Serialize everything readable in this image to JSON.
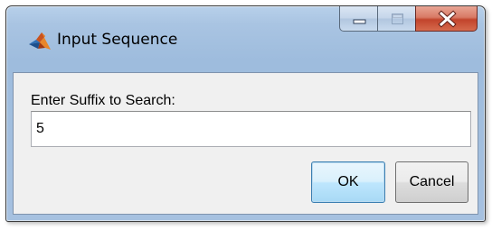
{
  "window": {
    "title": "Input Sequence",
    "app_icon": "matlab-membrane-icon",
    "caption_buttons": {
      "minimize_icon": "minimize-icon",
      "maximize_icon": "maximize-icon",
      "close_icon": "close-icon"
    }
  },
  "dialog": {
    "prompt": "Enter Suffix to Search:",
    "input_value": "5",
    "ok_label": "OK",
    "cancel_label": "Cancel"
  },
  "colors": {
    "frame": "#a9c4e2",
    "close_button": "#c2442c",
    "client_background": "#f0f0f0",
    "default_button_border": "#3c7fb1"
  }
}
